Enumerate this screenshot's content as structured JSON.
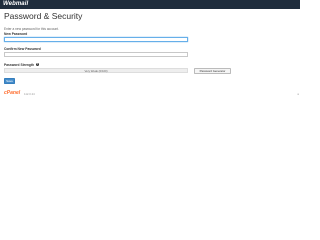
{
  "header": {
    "logo_text": "Webmail"
  },
  "page": {
    "title": "Password & Security",
    "instruction": "Enter a new password for this account."
  },
  "form": {
    "new_password": {
      "label": "New Password",
      "value": ""
    },
    "confirm_password": {
      "label": "Confirm New Password",
      "value": ""
    },
    "strength": {
      "label": "Password Strength",
      "meter_text": "Very Weak (0/100)",
      "percent": 0
    },
    "generator_button": "Password Generator",
    "save_button": "Save"
  },
  "footer": {
    "brand": "cPanel",
    "version": "112.0.24",
    "edge_mark": "≡"
  },
  "colors": {
    "topbar": "#1f2d3d",
    "primary": "#428bca",
    "brand": "#ff6c2c",
    "focus": "#66afe9"
  }
}
